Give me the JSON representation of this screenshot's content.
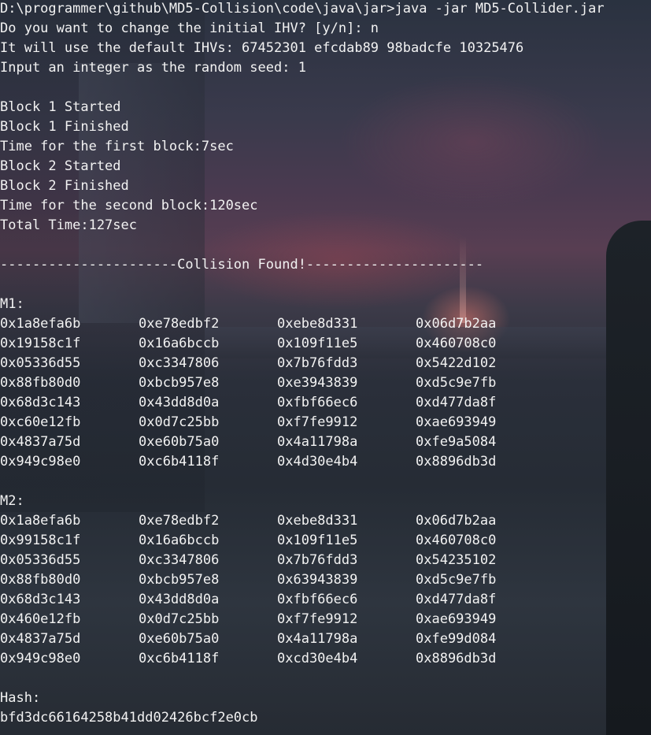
{
  "terminal": {
    "header_lines": [
      "D:\\programmer\\github\\MD5-Collision\\code\\java\\jar>java -jar MD5-Collider.jar",
      "Do you want to change the initial IHV? [y/n]: n",
      "It will use the default IHVs: 67452301 efcdab89 98badcfe 10325476",
      "Input an integer as the random seed: 1",
      "",
      "Block 1 Started",
      "Block 1 Finished",
      "Time for the first block:7sec",
      "Block 2 Started",
      "Block 2 Finished",
      "Time for the second block:120sec",
      "Total Time:127sec",
      "",
      "----------------------Collision Found!----------------------",
      ""
    ],
    "m1_label": "M1:",
    "m1_rows": [
      [
        "0x1a8efa6b",
        "0xe78edbf2",
        "0xebe8d331",
        "0x06d7b2aa"
      ],
      [
        "0x19158c1f",
        "0x16a6bccb",
        "0x109f11e5",
        "0x460708c0"
      ],
      [
        "0x05336d55",
        "0xc3347806",
        "0x7b76fdd3",
        "0x5422d102"
      ],
      [
        "0x88fb80d0",
        "0xbcb957e8",
        "0xe3943839",
        "0xd5c9e7fb"
      ],
      [
        "0x68d3c143",
        "0x43dd8d0a",
        "0xfbf66ec6",
        "0xd477da8f"
      ],
      [
        "0xc60e12fb",
        "0x0d7c25bb",
        "0xf7fe9912",
        "0xae693949"
      ],
      [
        "0x4837a75d",
        "0xe60b75a0",
        "0x4a11798a",
        "0xfe9a5084"
      ],
      [
        "0x949c98e0",
        "0xc6b4118f",
        "0x4d30e4b4",
        "0x8896db3d"
      ]
    ],
    "m2_label": "M2:",
    "m2_rows": [
      [
        "0x1a8efa6b",
        "0xe78edbf2",
        "0xebe8d331",
        "0x06d7b2aa"
      ],
      [
        "0x99158c1f",
        "0x16a6bccb",
        "0x109f11e5",
        "0x460708c0"
      ],
      [
        "0x05336d55",
        "0xc3347806",
        "0x7b76fdd3",
        "0x54235102"
      ],
      [
        "0x88fb80d0",
        "0xbcb957e8",
        "0x63943839",
        "0xd5c9e7fb"
      ],
      [
        "0x68d3c143",
        "0x43dd8d0a",
        "0xfbf66ec6",
        "0xd477da8f"
      ],
      [
        "0x460e12fb",
        "0x0d7c25bb",
        "0xf7fe9912",
        "0xae693949"
      ],
      [
        "0x4837a75d",
        "0xe60b75a0",
        "0x4a11798a",
        "0xfe99d084"
      ],
      [
        "0x949c98e0",
        "0xc6b4118f",
        "0xcd30e4b4",
        "0x8896db3d"
      ]
    ],
    "hash_label": "Hash:",
    "hash_value": "bfd3dc66164258b41dd02426bcf2e0cb"
  },
  "colors": {
    "text": "#f2f2f2"
  }
}
